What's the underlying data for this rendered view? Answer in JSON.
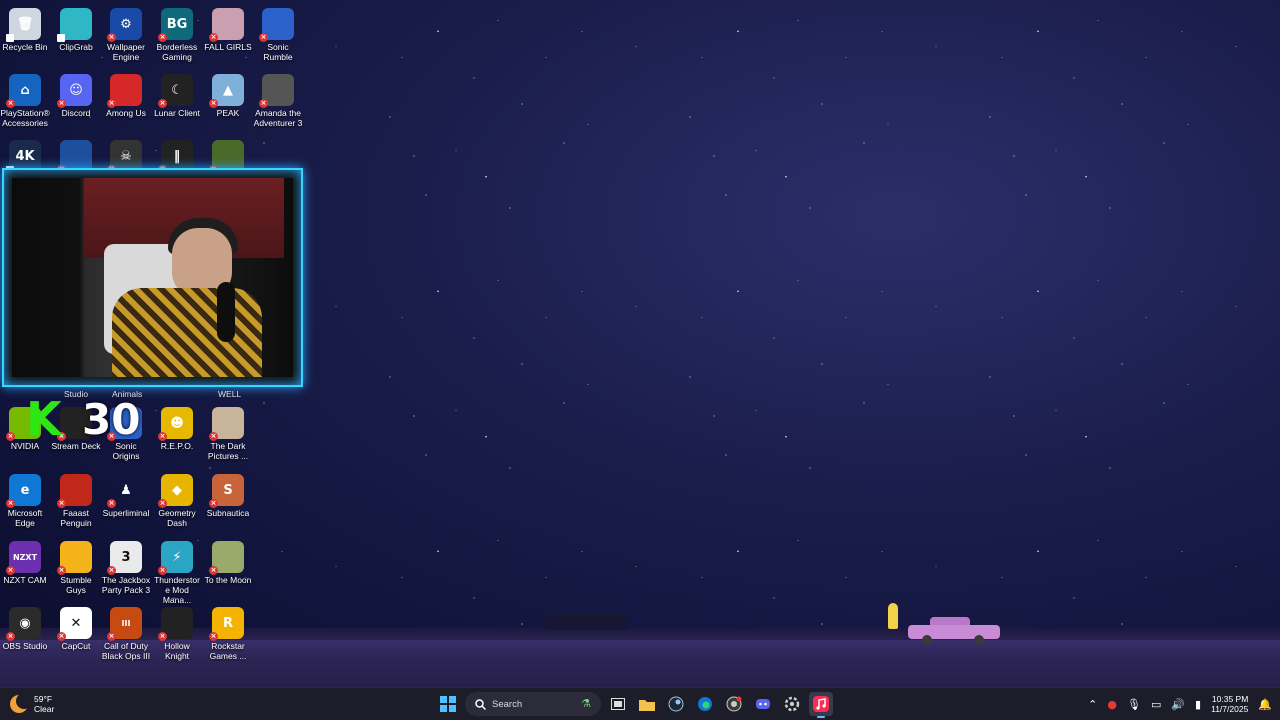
{
  "desktop": {
    "icons": [
      {
        "label": "Recycle Bin",
        "glyph": "🗑",
        "color": "#cfd6e0"
      },
      {
        "label": "ClipGrab",
        "glyph": "",
        "color": "#2fb7c6"
      },
      {
        "label": "Wallpaper Engine",
        "glyph": "⚙",
        "color": "#1a4aa8"
      },
      {
        "label": "Borderless Gaming",
        "glyph": "BG",
        "color": "#0e6a7a"
      },
      {
        "label": "FALL GIRLS",
        "glyph": "",
        "color": "#caa0b0"
      },
      {
        "label": "Sonic Rumble",
        "glyph": "",
        "color": "#2a62c9"
      },
      {
        "label": "PlayStation® Accessories",
        "glyph": "⌂",
        "color": "#1565c0"
      },
      {
        "label": "Discord",
        "glyph": "☺",
        "color": "#5865f2"
      },
      {
        "label": "Among Us",
        "glyph": "",
        "color": "#d62828"
      },
      {
        "label": "Lunar Client",
        "glyph": "☾",
        "color": "#222"
      },
      {
        "label": "PEAK",
        "glyph": "▲",
        "color": "#7fb0d9"
      },
      {
        "label": "Amanda the Adventurer 3",
        "glyph": "",
        "color": "#555"
      },
      {
        "label": "",
        "glyph": "4K",
        "color": "#1a2a4a"
      },
      {
        "label": "",
        "glyph": "",
        "color": "#1e4f9c"
      },
      {
        "label": "",
        "glyph": "☠",
        "color": "#333"
      },
      {
        "label": "",
        "glyph": "‖",
        "color": "#222"
      },
      {
        "label": "",
        "glyph": "",
        "color": "#4a6a2a"
      },
      {
        "label": "NVIDIA",
        "glyph": "",
        "color": "#76b900"
      },
      {
        "label": "Stream Deck",
        "glyph": "",
        "color": "#222"
      },
      {
        "label": "Sonic Origins",
        "glyph": "",
        "color": "#2a62c9"
      },
      {
        "label": "R.E.P.O.",
        "glyph": "☻",
        "color": "#e6b800"
      },
      {
        "label": "The Dark Pictures ...",
        "glyph": "",
        "color": "#c7b49a"
      },
      {
        "label": "Microsoft Edge",
        "glyph": "e",
        "color": "#0f78d4"
      },
      {
        "label": "Faaast Penguin",
        "glyph": "",
        "color": "#c2281a"
      },
      {
        "label": "Superliminal",
        "glyph": "♟",
        "color": "transparent"
      },
      {
        "label": "Geometry Dash",
        "glyph": "◆",
        "color": "#e7b500"
      },
      {
        "label": "Subnautica",
        "glyph": "S",
        "color": "#c8643a"
      },
      {
        "label": "NZXT CAM",
        "glyph": "NZXT",
        "color": "#6b2fb0"
      },
      {
        "label": "Stumble Guys",
        "glyph": "",
        "color": "#f4b21b"
      },
      {
        "label": "The Jackbox Party Pack 3",
        "glyph": "3",
        "color": "#eaeaea"
      },
      {
        "label": "Thunderstore Mod Mana...",
        "glyph": "⚡",
        "color": "#2aa6c4"
      },
      {
        "label": "To the Moon",
        "glyph": "",
        "color": "#9aaa6a"
      },
      {
        "label": "OBS Studio",
        "glyph": "◉",
        "color": "#2b2b2b"
      },
      {
        "label": "CapCut",
        "glyph": "✕",
        "color": "#fff"
      },
      {
        "label": "Call of Duty Black Ops III",
        "glyph": "III",
        "color": "#c64a12"
      },
      {
        "label": "Hollow Knight",
        "glyph": "",
        "color": "#222"
      },
      {
        "label": "Rockstar Games ...",
        "glyph": "R",
        "color": "#f4b300"
      }
    ],
    "hidden_labels": [
      "Studio",
      "Animals",
      "WELL"
    ],
    "overlay": {
      "k": "K",
      "num": "30"
    }
  },
  "taskbar": {
    "weather": {
      "temp": "59°F",
      "condition": "Clear"
    },
    "search_placeholder": "Search",
    "clock": {
      "time": "10:35 PM",
      "date": "11/7/2025"
    }
  }
}
